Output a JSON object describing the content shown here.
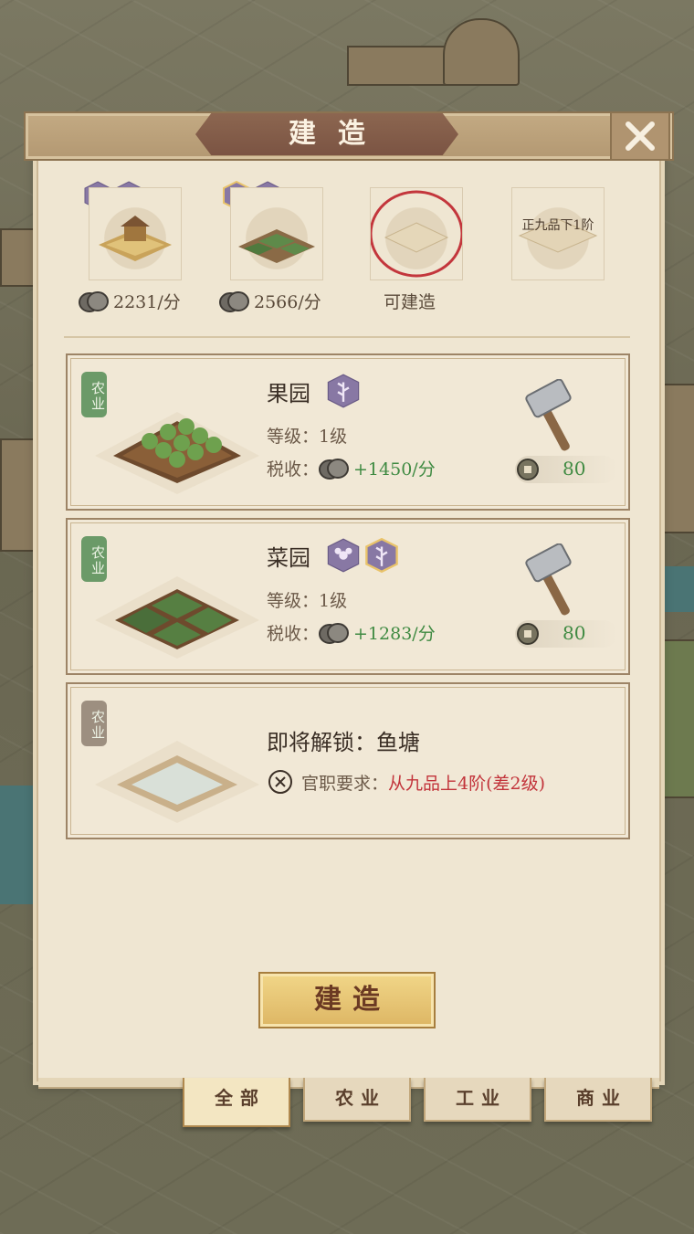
{
  "dialog": {
    "title": "建造",
    "build_button": "建造",
    "close_icon": "close-x-icon"
  },
  "summary": [
    {
      "label": "2231/分",
      "badges": [
        "cotton-badge-icon",
        "silk-badge-icon"
      ],
      "icon": "farmstead-icon",
      "coin": "copper-coin-icon"
    },
    {
      "label": "2566/分",
      "badges": [
        "wheat-badge-icon",
        "flower-badge-icon"
      ],
      "icon": "vegetable-plot-icon",
      "coin": "copper-coin-icon"
    },
    {
      "label": "可建造",
      "icon": "empty-plot-icon"
    },
    {
      "label": "正九品下1阶",
      "icon": "locked-plot-icon"
    }
  ],
  "buildings": [
    {
      "tag": "农业",
      "name": "果园",
      "level": "等级：1级",
      "tax_label": "税收：",
      "tax_value": "+1450/分",
      "cost": "80",
      "badges": [
        "fruit-badge-icon"
      ]
    },
    {
      "tag": "农业",
      "name": "菜园",
      "level": "等级：1级",
      "tax_label": "税收：",
      "tax_value": "+1283/分",
      "cost": "80",
      "badges": [
        "herb-badge-icon",
        "wheat-badge-icon"
      ]
    },
    {
      "tag": "农业",
      "name": "即将解锁：鱼塘",
      "req_label": "官职要求：",
      "req_value": "从九品上4阶(差2级)"
    }
  ],
  "tabs": [
    {
      "label": "全部",
      "active": true
    },
    {
      "label": "农业",
      "active": false
    },
    {
      "label": "工业",
      "active": false
    },
    {
      "label": "商业",
      "active": false
    }
  ],
  "colors": {
    "panel": "#efe6d2",
    "title_plate": "#7b5443",
    "green_text": "#3f8a42",
    "red_text": "#c2333a",
    "build_button": "#e8c775"
  }
}
